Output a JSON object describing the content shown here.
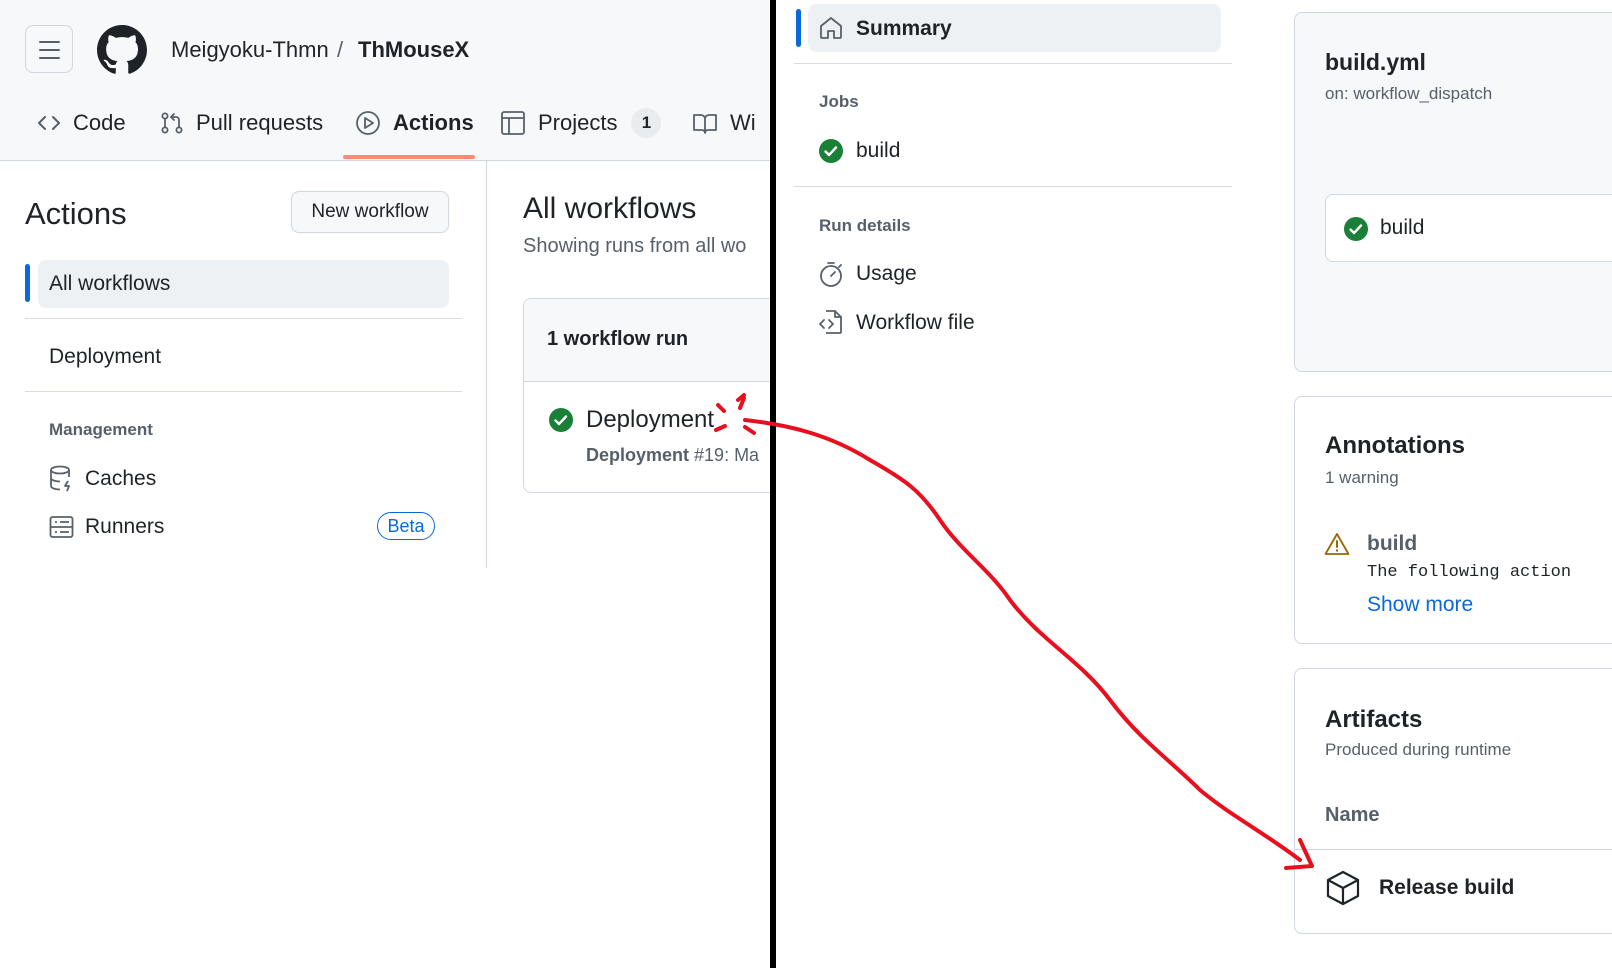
{
  "left": {
    "header": {
      "owner": "Meigyoku-Thmn",
      "separator": "/",
      "repo": "ThMouseX",
      "tabs": [
        {
          "label": "Code",
          "icon": "code-icon"
        },
        {
          "label": "Pull requests",
          "icon": "pull-request-icon"
        },
        {
          "label": "Actions",
          "icon": "play-icon",
          "selected": true
        },
        {
          "label": "Projects",
          "icon": "table-icon",
          "counter": "1"
        },
        {
          "label": "Wiki",
          "visible_text": "Wi",
          "icon": "book-icon"
        }
      ]
    },
    "sidebar": {
      "title": "Actions",
      "new_workflow_button": "New workflow",
      "all_workflows": "All workflows",
      "deployment": "Deployment",
      "management_heading": "Management",
      "caches": "Caches",
      "runners": "Runners",
      "runners_badge": "Beta"
    },
    "main": {
      "title": "All workflows",
      "subtitle": "Showing runs from all wo",
      "runs_header": "1 workflow run",
      "run": {
        "name": "Deployment",
        "meta_name": "Deployment",
        "meta_rest": " #19: Ma",
        "status": "success"
      }
    }
  },
  "right": {
    "nav": {
      "summary": "Summary",
      "jobs_heading": "Jobs",
      "job": "build",
      "run_details_heading": "Run details",
      "usage": "Usage",
      "workflow_file": "Workflow file"
    },
    "workflow_card": {
      "filename": "build.yml",
      "trigger": "on: workflow_dispatch",
      "job": "build"
    },
    "annotations": {
      "title": "Annotations",
      "count": "1 warning",
      "item_title": "build",
      "item_text": "The following action",
      "show_more": "Show more"
    },
    "artifacts": {
      "title": "Artifacts",
      "subtitle": "Produced during runtime",
      "column_name": "Name",
      "item": "Release build"
    }
  },
  "colors": {
    "accent_blue": "#0969da",
    "success_green": "#1a7f37",
    "warning_yellow": "#9a6700",
    "tab_underline": "#fd8c73",
    "annotation_red": "#e8101f"
  }
}
